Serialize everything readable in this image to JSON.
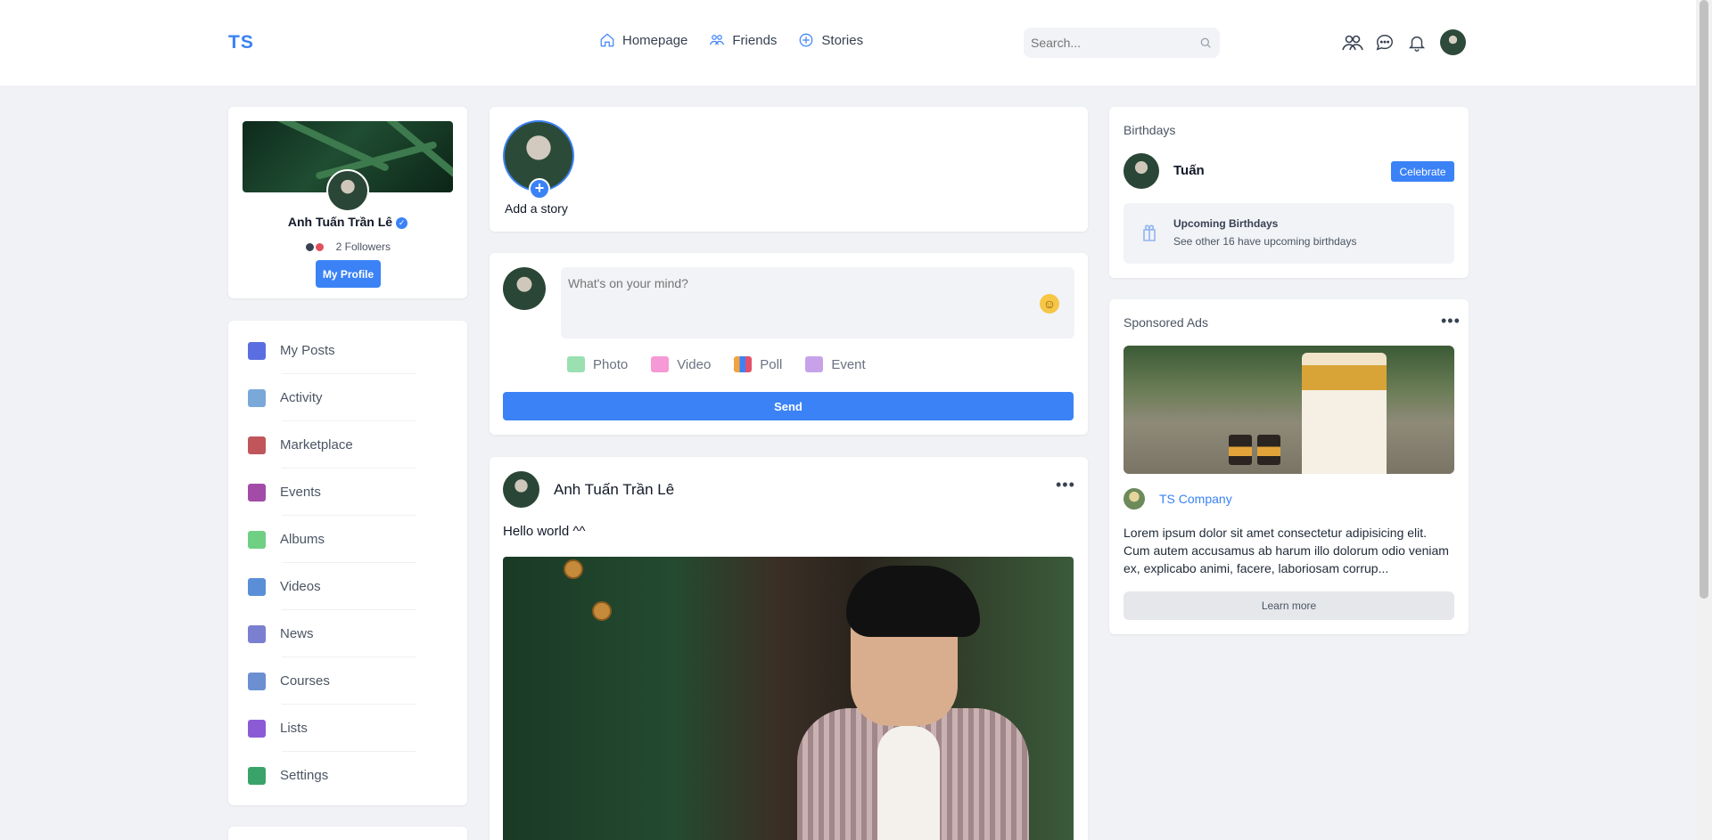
{
  "header": {
    "logo": "TS",
    "nav": [
      {
        "label": "Homepage",
        "icon": "home-icon"
      },
      {
        "label": "Friends",
        "icon": "friends-icon"
      },
      {
        "label": "Stories",
        "icon": "stories-icon"
      }
    ],
    "search_placeholder": "Search...",
    "icons": [
      "friend-requests-icon",
      "messages-icon",
      "notifications-icon",
      "user-avatar"
    ]
  },
  "profile": {
    "name": "Anh Tuấn Trần Lê",
    "followers": "2 Followers",
    "button": "My Profile"
  },
  "menu": [
    {
      "label": "My Posts",
      "icon": "my-posts-icon",
      "color": "#5b6ee1"
    },
    {
      "label": "Activity",
      "icon": "activity-icon",
      "color": "#7aa9d9"
    },
    {
      "label": "Marketplace",
      "icon": "marketplace-icon",
      "color": "#c0565b"
    },
    {
      "label": "Events",
      "icon": "events-icon",
      "color": "#a24ca8"
    },
    {
      "label": "Albums",
      "icon": "albums-icon",
      "color": "#6fcf83"
    },
    {
      "label": "Videos",
      "icon": "videos-icon",
      "color": "#5a8fd8"
    },
    {
      "label": "News",
      "icon": "news-icon",
      "color": "#7b7fd0"
    },
    {
      "label": "Courses",
      "icon": "courses-icon",
      "color": "#6b8fd1"
    },
    {
      "label": "Lists",
      "icon": "lists-icon",
      "color": "#8b5bd6"
    },
    {
      "label": "Settings",
      "icon": "settings-icon",
      "color": "#3aa36a"
    }
  ],
  "stories": {
    "add_label": "Add a story"
  },
  "composer": {
    "placeholder": "What's on your mind?",
    "options": [
      {
        "label": "Photo",
        "icon": "photo-icon",
        "color": "#9be0b0"
      },
      {
        "label": "Video",
        "icon": "video-icon",
        "color": "#f59ad6"
      },
      {
        "label": "Poll",
        "icon": "poll-icon",
        "color": "#f0a340"
      },
      {
        "label": "Event",
        "icon": "event-icon",
        "color": "#c7a2e8"
      }
    ],
    "send_label": "Send"
  },
  "post": {
    "author": "Anh Tuấn Trần Lê",
    "text": "Hello world ^^"
  },
  "birthdays": {
    "title": "Birthdays",
    "person": "Tuấn",
    "button": "Celebrate",
    "upcoming_title": "Upcoming Birthdays",
    "upcoming_sub": "See other 16 have upcoming birthdays"
  },
  "ads": {
    "title": "Sponsored Ads",
    "company": "TS Company",
    "text": "Lorem ipsum dolor sit amet consectetur adipisicing elit. Cum autem accusamus ab harum illo dolorum odio veniam ex, explicabo animi, facere, laboriosam corrup...",
    "button": "Learn more"
  },
  "colors": {
    "accent": "#3b82f6",
    "background": "#f0f2f5"
  }
}
